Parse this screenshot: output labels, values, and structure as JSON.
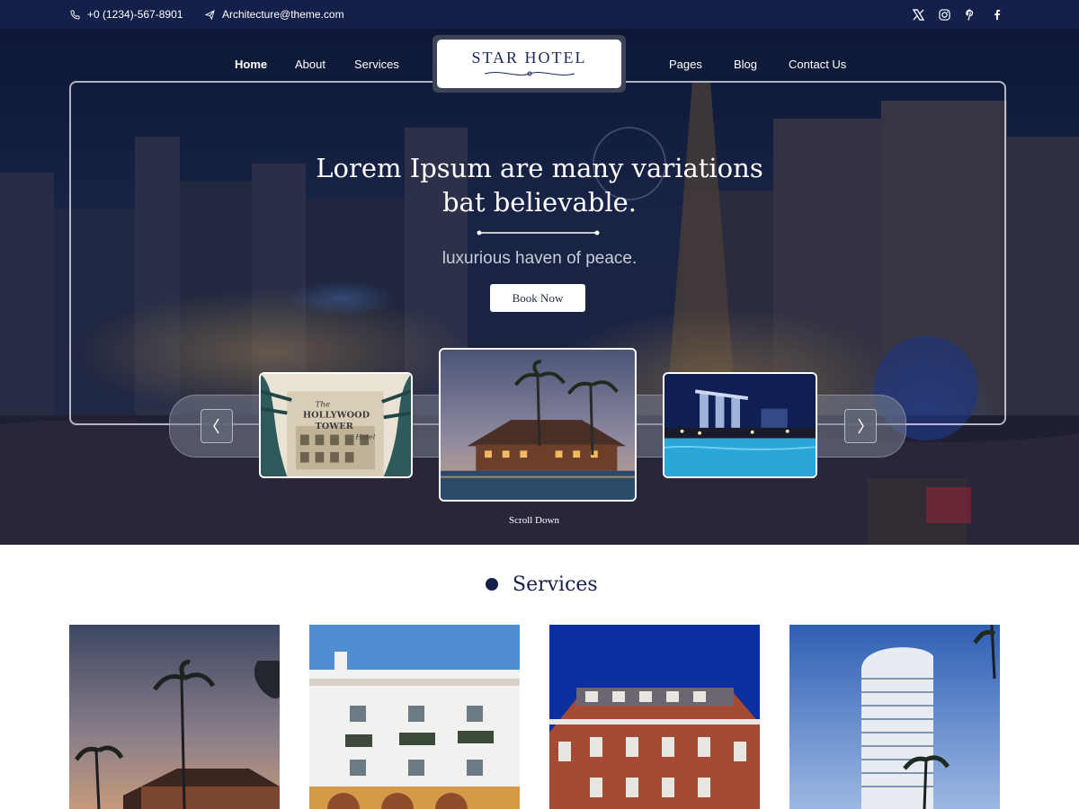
{
  "topbar": {
    "phone": "+0 (1234)-567-8901",
    "email": "Architecture@theme.com",
    "socials": [
      "x-icon",
      "instagram-icon",
      "pinterest-icon",
      "facebook-icon"
    ]
  },
  "nav": {
    "left": [
      "Home",
      "About",
      "Services"
    ],
    "right": [
      "Pages",
      "Blog",
      "Contact Us"
    ],
    "active": "Home"
  },
  "logo": {
    "text": "STAR HOTEL"
  },
  "hero": {
    "title_line1": "Lorem Ipsum are many variations",
    "title_line2": "bat believable.",
    "subtitle": "luxurious haven of peace.",
    "button": "Book Now",
    "scroll": "Scroll Down"
  },
  "slider": {
    "thumbs": [
      "hollywood-tower-hotel-image",
      "resort-pool-dusk-image",
      "marina-bay-pool-image"
    ],
    "thumb1_sign": [
      "The",
      "HOLLYWOOD",
      "TOWER",
      "Hotel"
    ]
  },
  "services": {
    "heading": "Services",
    "cards": [
      "palm-resort-image",
      "white-hotel-image",
      "brick-hotel-image",
      "tower-hotel-image"
    ]
  },
  "colors": {
    "navy": "#14204a",
    "white": "#ffffff",
    "subtitle": "#c9ccd6"
  }
}
